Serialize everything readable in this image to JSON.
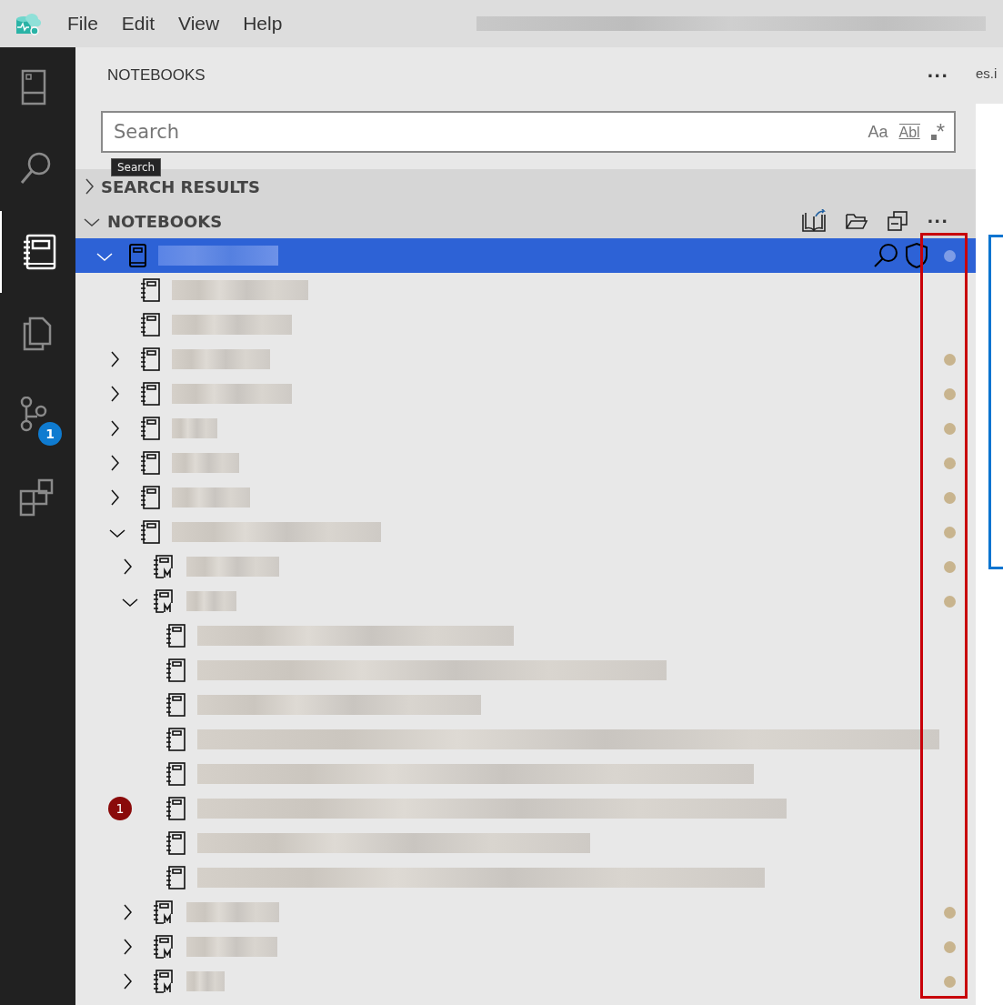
{
  "menu": [
    "File",
    "Edit",
    "View",
    "Help"
  ],
  "activity": [
    {
      "kind": "page",
      "selected": false
    },
    {
      "kind": "search",
      "selected": false
    },
    {
      "kind": "book",
      "selected": true
    },
    {
      "kind": "copies",
      "selected": false
    },
    {
      "kind": "branch",
      "selected": false,
      "badge": "1"
    },
    {
      "kind": "blocks",
      "selected": false
    }
  ],
  "panel": {
    "title": "NOTEBOOKS",
    "more": "···"
  },
  "search": {
    "placeholder": "Search",
    "options": [
      "Aa",
      "Abl",
      "*"
    ],
    "tooltip": "Search"
  },
  "sections": [
    {
      "title": "SEARCH RESULTS",
      "expanded": false
    },
    {
      "title": "NOTEBOOKS",
      "expanded": true,
      "more": "···"
    }
  ],
  "editor_tab": "es.i",
  "tree": [
    {
      "kind": "book",
      "expanded": true,
      "selected": true,
      "dot": true,
      "children": [
        {
          "kind": "notebook",
          "selected": false,
          "dot": false
        },
        {
          "kind": "notebook",
          "selected": false,
          "dot": false
        },
        {
          "kind": "notebook",
          "expanded": false,
          "selected": false,
          "dot": true
        },
        {
          "kind": "notebook",
          "expanded": false,
          "selected": false,
          "dot": true
        },
        {
          "kind": "notebook",
          "expanded": false,
          "selected": false,
          "dot": true
        },
        {
          "kind": "notebook",
          "expanded": false,
          "selected": false,
          "dot": true
        },
        {
          "kind": "notebook",
          "expanded": false,
          "selected": false,
          "dot": true
        },
        {
          "kind": "notebook",
          "expanded": true,
          "selected": false,
          "dot": true,
          "children": [
            {
              "kind": "markdown",
              "expanded": false,
              "selected": false,
              "dot": true
            },
            {
              "kind": "markdown",
              "expanded": true,
              "selected": false,
              "dot": true,
              "children": [
                {
                  "kind": "notebook",
                  "selected": false,
                  "dot": false
                },
                {
                  "kind": "notebook",
                  "selected": false,
                  "dot": false
                },
                {
                  "kind": "notebook",
                  "selected": false,
                  "dot": false
                },
                {
                  "kind": "notebook",
                  "selected": false,
                  "dot": false
                },
                {
                  "kind": "notebook",
                  "selected": false,
                  "dot": false
                },
                {
                  "kind": "notebook",
                  "selected": false,
                  "dot": false,
                  "badge": "1"
                },
                {
                  "kind": "notebook",
                  "selected": false,
                  "dot": false
                },
                {
                  "kind": "notebook",
                  "selected": false,
                  "dot": false
                }
              ]
            },
            {
              "kind": "markdown",
              "expanded": false,
              "selected": false,
              "dot": true
            },
            {
              "kind": "markdown",
              "expanded": false,
              "selected": false,
              "dot": true
            },
            {
              "kind": "markdown",
              "expanded": false,
              "selected": false,
              "dot": true
            }
          ]
        }
      ]
    }
  ]
}
